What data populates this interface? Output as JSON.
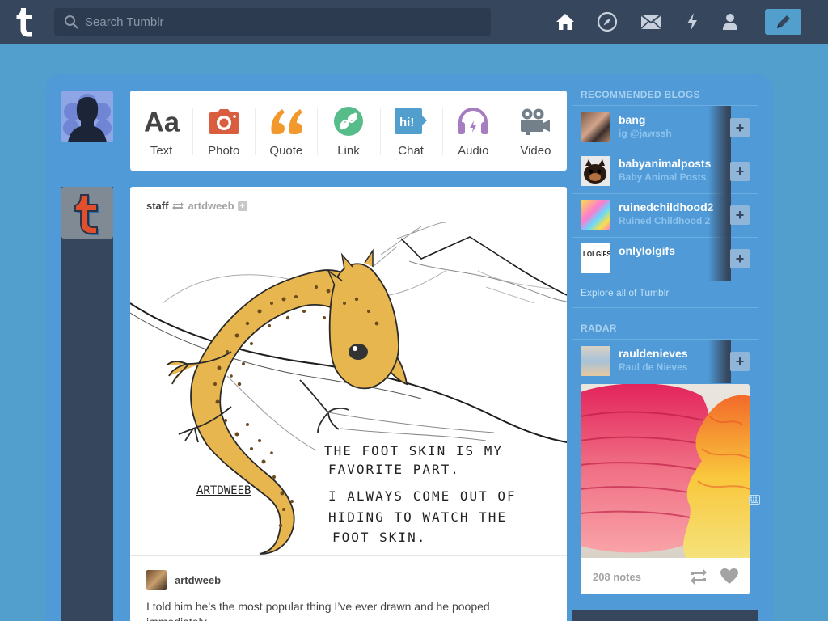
{
  "topbar": {
    "search_placeholder": "Search Tumblr"
  },
  "post_types": [
    {
      "label": "Text",
      "icon": "text-icon",
      "color": "#444444"
    },
    {
      "label": "Photo",
      "icon": "camera-icon",
      "color": "#d95e40"
    },
    {
      "label": "Quote",
      "icon": "quote-icon",
      "color": "#f2992e"
    },
    {
      "label": "Link",
      "icon": "link-icon",
      "color": "#56bc8a"
    },
    {
      "label": "Chat",
      "icon": "chat-icon",
      "color": "#529ecc"
    },
    {
      "label": "Audio",
      "icon": "headphones-icon",
      "color": "#a77dc2"
    },
    {
      "label": "Video",
      "icon": "video-camera-icon",
      "color": "#748089"
    }
  ],
  "post": {
    "author": "staff",
    "reblogged_from": "artdweeb",
    "art_text": {
      "signature": "ARTDWEEB",
      "line1": "THE FOOT SKIN IS MY",
      "line2": "FAVORITE PART.",
      "line3": "I ALWAYS COME OUT OF",
      "line4": "HIDING TO WATCH THE",
      "line5": "FOOT SKIN."
    },
    "caption_user": "artdweeb",
    "caption_text": "I told him he’s the most popular thing I’ve ever drawn and he pooped immediately."
  },
  "sidebar": {
    "recommended_title": "RECOMMENDED BLOGS",
    "recommended": [
      {
        "name": "bang",
        "subtitle": "ig @jawssh"
      },
      {
        "name": "babyanimalposts",
        "subtitle": "Baby Animal Posts"
      },
      {
        "name": "ruinedchildhood2",
        "subtitle": "Ruined Childhood 2"
      },
      {
        "name": "onlylolgifs",
        "subtitle": "",
        "avatar_text": "LOLGIFS.NET"
      }
    ],
    "follow_symbol": "+",
    "explore_label": "Explore all of Tumblr",
    "radar_title": "RADAR",
    "radar": {
      "name": "rauldenieves",
      "subtitle": "Raul de Nieves",
      "notes": "208 notes"
    }
  },
  "colors": {
    "navy": "#36465d",
    "blue": "#529ecc",
    "shell": "#4f9ad7"
  }
}
